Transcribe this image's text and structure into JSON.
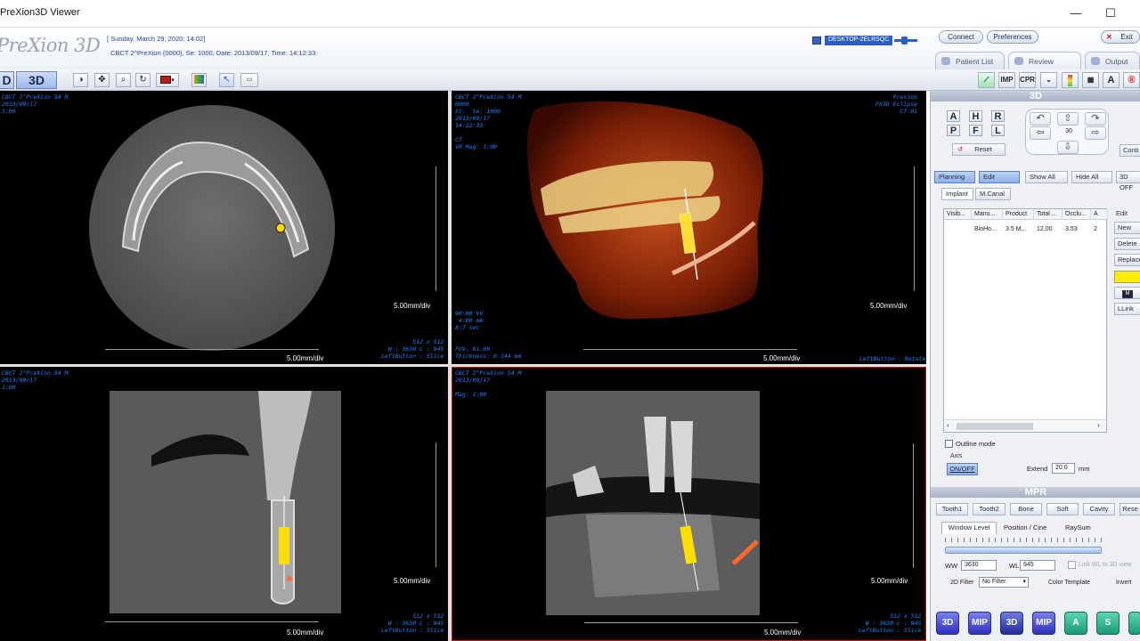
{
  "window": {
    "title": "PreXion3D Viewer",
    "minimize": "—",
    "maximize": "☐"
  },
  "header": {
    "logo": "PreXion 3D",
    "date_line": "[ Sunday, March 29, 2020: 14:02]",
    "study_line": "CBCT 2^PreXion (0000), Se: 1000, Date: 2013/09/17, Time: 14:12:33",
    "computer": "DESKTOP-2ELRSQC",
    "connect": "Connect",
    "preferences": "Preferences",
    "exit": "Exit",
    "tabs": [
      {
        "label": "Patient List"
      },
      {
        "label": "Review"
      },
      {
        "label": "Output"
      }
    ]
  },
  "toolbar": {
    "mode_2d": "D",
    "mode_3d": "3D",
    "right_tools": [
      "IMP",
      "CPR",
      "A"
    ]
  },
  "viewports": {
    "axial": {
      "info_top": "CBCT 2^PreXion 54 M\n2013/09/17\n1:00",
      "scale_side": "5.00mm/div",
      "scale_bottom": "5.00mm/div",
      "info_bottom": "512 x 512\nW : 3630 L : 945\nLeftButton : Slice"
    },
    "render3d": {
      "info_top": "CBCT 2^PreXion 54 M\n0000\nSt:  Se: 1000\n2013/09/17\n14:12:33\n\nCT\nVR Mag: 1:00",
      "info_right": "Prexion\nPX3D Eclipse\nCT-01",
      "info_mid": "90:00 kV\n 4:00 mA\n8:7 sec",
      "info_bottom": "FOV: 81.00\nThickness: 0.144 mm",
      "info_bottom_right": "LeftButton : Rotate",
      "scale_side": "5.00mm/div",
      "scale_bottom": "5.00mm/div"
    },
    "cross": {
      "info_top": "CBCT 2^PreXion 54 M\n2013/09/17\n1:00",
      "scale_side": "5.00mm/div",
      "scale_bottom": "5.00mm/div",
      "info_bottom": "512 x 512\nW : 3630 L : 945\nLeftButton : Slice"
    },
    "panoramic": {
      "info_top": "CBCT 2^PreXion 54 M\n2013/09/17\n\nMag: 1:00",
      "scale_side": "5.00mm/div",
      "scale_bottom": "5.00mm/div",
      "info_bottom": "512 x 512\nW : 3630 L : 945\nLeftButton : Slice"
    }
  },
  "panel3d": {
    "title": "3D",
    "view_letters": [
      "A",
      "H",
      "R",
      "P",
      "F",
      "L"
    ],
    "reset": "Reset",
    "rotation_step": "30",
    "cont": "Conti"
  },
  "planning": {
    "tabs": [
      "Planning",
      "Edit",
      "Show All",
      "Hide All",
      "3D OFF"
    ],
    "subtabs": [
      "Implant",
      "M.Canal"
    ],
    "columns": [
      "Visib...",
      "Manu...",
      "Product",
      "Total ...",
      "Occlu...",
      "A"
    ],
    "rows": [
      {
        "manufacturer": "BioHo...",
        "product": "3.5 M...",
        "total": "12.00",
        "occlusal": "3.53",
        "a": "2"
      }
    ],
    "edit_label": "Edit",
    "edit_buttons": [
      "New",
      "Delete",
      "Replace"
    ],
    "link": "LLink",
    "outline_mode": "Outline mode",
    "axis_label": "Axis",
    "axis_toggle": "ON/OFF",
    "extend_label": "Extend",
    "extend_value": "20.0",
    "extend_unit": "mm",
    "highlight_color": "#ffee00"
  },
  "mpr": {
    "title": "MPR",
    "presets": [
      "Tooth1",
      "Tooth2",
      "Bone",
      "Soft",
      "Cavity",
      "Rese"
    ],
    "tabs": [
      "Window Level",
      "Position / Cine",
      "RaySum"
    ],
    "ww_label": "WW",
    "ww_value": "3630",
    "wl_label": "WL",
    "wl_value": "945",
    "link_label": "Link WL to 3D view",
    "filter_label": "2D Filter",
    "filter_value": "No Filter",
    "color_template": "Color Template",
    "invert": "Invert",
    "bottom_buttons": [
      "3D",
      "MIP",
      "3D",
      "MIP",
      "A",
      "S"
    ]
  }
}
